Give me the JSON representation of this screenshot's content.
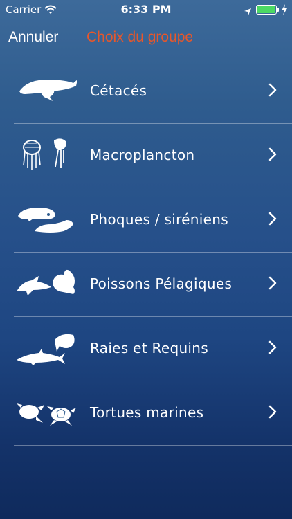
{
  "status_bar": {
    "carrier": "Carrier",
    "time": "6:33 PM",
    "battery_color": "#4cd964"
  },
  "nav": {
    "cancel": "Annuler",
    "title": "Choix du groupe",
    "title_color": "#e8572a"
  },
  "groups": [
    {
      "label": "Cétacés",
      "icon": "whale-icon"
    },
    {
      "label": "Macroplancton",
      "icon": "jellyfish-icon"
    },
    {
      "label": "Phoques / siréniens",
      "icon": "seal-icon"
    },
    {
      "label": "Poissons Pélagiques",
      "icon": "fish-icon"
    },
    {
      "label": "Raies et Requins",
      "icon": "shark-ray-icon"
    },
    {
      "label": "Tortues marines",
      "icon": "turtle-icon"
    }
  ]
}
